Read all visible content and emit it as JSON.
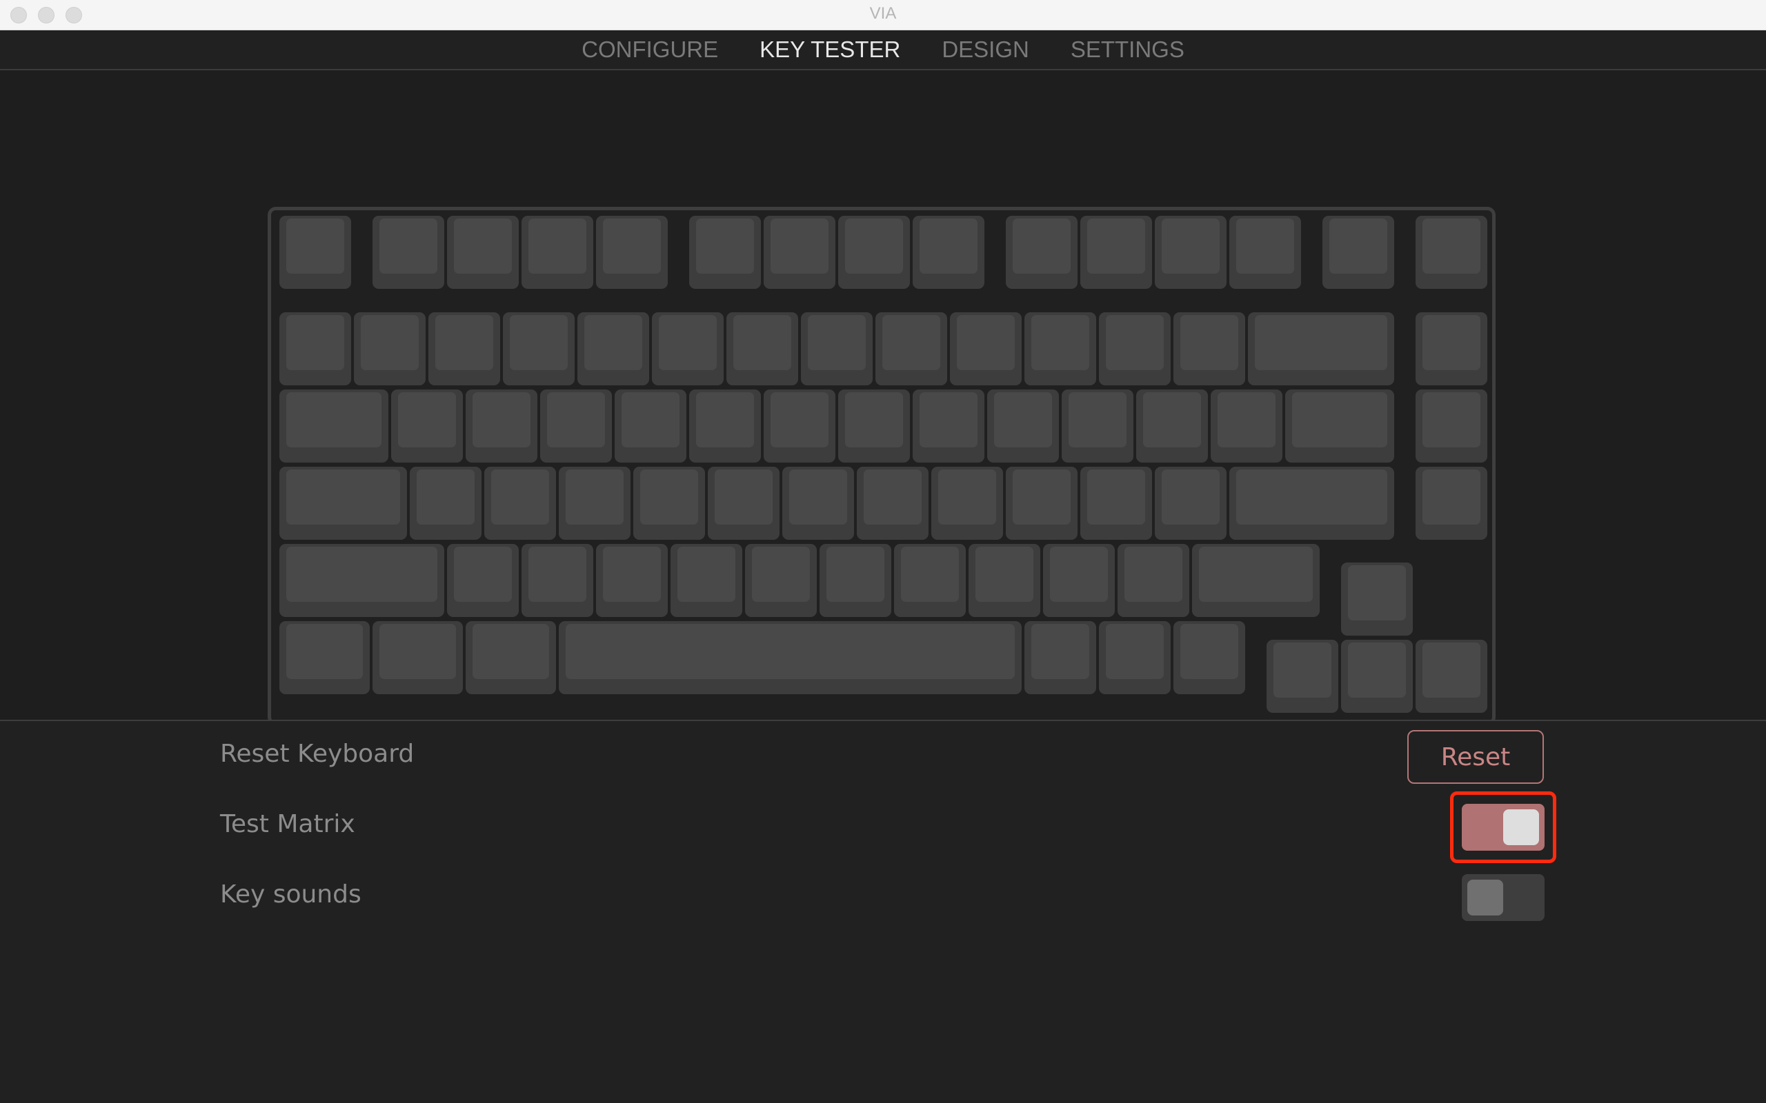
{
  "window": {
    "title": "VIA"
  },
  "nav": {
    "tabs": [
      {
        "label": "CONFIGURE",
        "active": false
      },
      {
        "label": "KEY TESTER",
        "active": true
      },
      {
        "label": "DESIGN",
        "active": false
      },
      {
        "label": "SETTINGS",
        "active": false
      }
    ]
  },
  "keyboard": {
    "layout": "75%",
    "rows": [
      {
        "name": "function-row",
        "keys": [
          {
            "w": 1,
            "x": 0
          },
          {
            "w": 1,
            "x": 1.25
          },
          {
            "w": 1,
            "x": 2.25
          },
          {
            "w": 1,
            "x": 3.25
          },
          {
            "w": 1,
            "x": 4.25
          },
          {
            "w": 1,
            "x": 5.5
          },
          {
            "w": 1,
            "x": 6.5
          },
          {
            "w": 1,
            "x": 7.5
          },
          {
            "w": 1,
            "x": 8.5
          },
          {
            "w": 1,
            "x": 9.75
          },
          {
            "w": 1,
            "x": 10.75
          },
          {
            "w": 1,
            "x": 11.75
          },
          {
            "w": 1,
            "x": 12.75
          },
          {
            "w": 1,
            "x": 14
          },
          {
            "w": 1,
            "x": 15.25
          }
        ]
      },
      {
        "name": "number-row",
        "keys": [
          {
            "w": 1,
            "x": 0
          },
          {
            "w": 1,
            "x": 1
          },
          {
            "w": 1,
            "x": 2
          },
          {
            "w": 1,
            "x": 3
          },
          {
            "w": 1,
            "x": 4
          },
          {
            "w": 1,
            "x": 5
          },
          {
            "w": 1,
            "x": 6
          },
          {
            "w": 1,
            "x": 7
          },
          {
            "w": 1,
            "x": 8
          },
          {
            "w": 1,
            "x": 9
          },
          {
            "w": 1,
            "x": 10
          },
          {
            "w": 1,
            "x": 11
          },
          {
            "w": 1,
            "x": 12
          },
          {
            "w": 2,
            "x": 13
          },
          {
            "w": 1,
            "x": 15.25
          }
        ]
      },
      {
        "name": "tab-row",
        "keys": [
          {
            "w": 1.5,
            "x": 0
          },
          {
            "w": 1,
            "x": 1.5
          },
          {
            "w": 1,
            "x": 2.5
          },
          {
            "w": 1,
            "x": 3.5
          },
          {
            "w": 1,
            "x": 4.5
          },
          {
            "w": 1,
            "x": 5.5
          },
          {
            "w": 1,
            "x": 6.5
          },
          {
            "w": 1,
            "x": 7.5
          },
          {
            "w": 1,
            "x": 8.5
          },
          {
            "w": 1,
            "x": 9.5
          },
          {
            "w": 1,
            "x": 10.5
          },
          {
            "w": 1,
            "x": 11.5
          },
          {
            "w": 1,
            "x": 12.5
          },
          {
            "w": 1.5,
            "x": 13.5
          },
          {
            "w": 1,
            "x": 15.25
          }
        ]
      },
      {
        "name": "caps-row",
        "keys": [
          {
            "w": 1.75,
            "x": 0
          },
          {
            "w": 1,
            "x": 1.75
          },
          {
            "w": 1,
            "x": 2.75
          },
          {
            "w": 1,
            "x": 3.75
          },
          {
            "w": 1,
            "x": 4.75
          },
          {
            "w": 1,
            "x": 5.75
          },
          {
            "w": 1,
            "x": 6.75
          },
          {
            "w": 1,
            "x": 7.75
          },
          {
            "w": 1,
            "x": 8.75
          },
          {
            "w": 1,
            "x": 9.75
          },
          {
            "w": 1,
            "x": 10.75
          },
          {
            "w": 1,
            "x": 11.75
          },
          {
            "w": 2.25,
            "x": 12.75
          },
          {
            "w": 1,
            "x": 15.25
          }
        ]
      },
      {
        "name": "shift-row",
        "keys": [
          {
            "w": 2.25,
            "x": 0
          },
          {
            "w": 1,
            "x": 2.25
          },
          {
            "w": 1,
            "x": 3.25
          },
          {
            "w": 1,
            "x": 4.25
          },
          {
            "w": 1,
            "x": 5.25
          },
          {
            "w": 1,
            "x": 6.25
          },
          {
            "w": 1,
            "x": 7.25
          },
          {
            "w": 1,
            "x": 8.25
          },
          {
            "w": 1,
            "x": 9.25
          },
          {
            "w": 1,
            "x": 10.25
          },
          {
            "w": 1,
            "x": 11.25
          },
          {
            "w": 1.75,
            "x": 12.25
          },
          {
            "w": 1,
            "x": 14.25,
            "dy": 0.25
          }
        ]
      },
      {
        "name": "bottom-row",
        "keys": [
          {
            "w": 1.25,
            "x": 0
          },
          {
            "w": 1.25,
            "x": 1.25
          },
          {
            "w": 1.25,
            "x": 2.5
          },
          {
            "w": 6.25,
            "x": 3.75
          },
          {
            "w": 1,
            "x": 10
          },
          {
            "w": 1,
            "x": 11
          },
          {
            "w": 1,
            "x": 12
          },
          {
            "w": 1,
            "x": 13.25,
            "dy": 0.25
          },
          {
            "w": 1,
            "x": 14.25,
            "dy": 0.25
          },
          {
            "w": 1,
            "x": 15.25,
            "dy": 0.25
          }
        ]
      }
    ]
  },
  "settings": {
    "rows": [
      {
        "label": "Reset Keyboard",
        "control": "button",
        "button_label": "Reset"
      },
      {
        "label": "Test Matrix",
        "control": "toggle",
        "on": true
      },
      {
        "label": "Key sounds",
        "control": "toggle",
        "on": false
      }
    ]
  },
  "colors": {
    "accent": "#b07272",
    "highlight_outline": "#ff2b0f",
    "key_base": "#3d3d3d",
    "key_cap": "#494949"
  }
}
